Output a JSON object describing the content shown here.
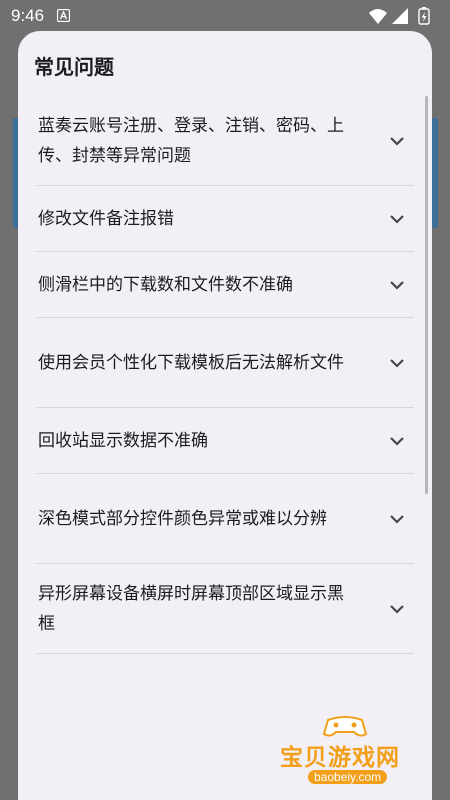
{
  "status_bar": {
    "time": "9:46"
  },
  "dialog": {
    "title": "常见问题",
    "items": [
      {
        "label": "蓝奏云账号注册、登录、注销、密码、上传、封禁等异常问题"
      },
      {
        "label": "修改文件备注报错"
      },
      {
        "label": "侧滑栏中的下载数和文件数不准确"
      },
      {
        "label": "使用会员个性化下载模板后无法解析文件"
      },
      {
        "label": "回收站显示数据不准确"
      },
      {
        "label": "深色模式部分控件颜色异常或难以分辨"
      },
      {
        "label": "异形屏幕设备横屏时屏幕顶部区域显示黑框"
      }
    ]
  },
  "watermark": {
    "name": "宝贝游戏网",
    "url": "baobeiy.com"
  },
  "colors": {
    "dialog_bg": "#f2f0f6",
    "watermark": "#f29f1a"
  }
}
